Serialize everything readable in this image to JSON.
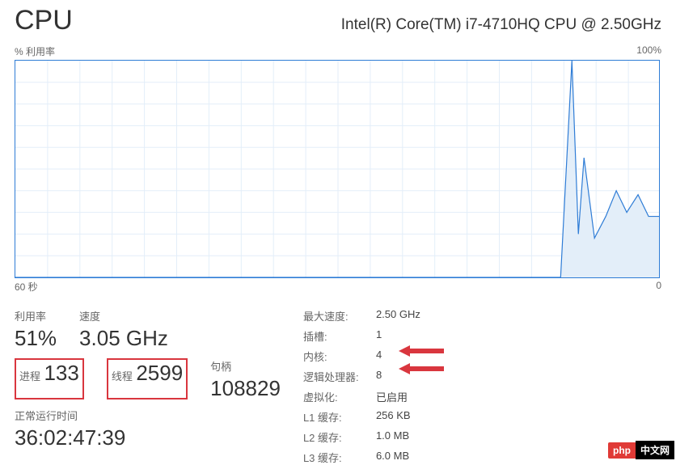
{
  "header": {
    "title": "CPU",
    "cpu_name": "Intel(R) Core(TM) i7-4710HQ CPU @ 2.50GHz"
  },
  "chart": {
    "top_left": "% 利用率",
    "top_right": "100%",
    "bottom_left": "60 秒",
    "bottom_right": "0"
  },
  "chart_data": {
    "type": "line",
    "title": "% 利用率",
    "xlabel": "秒",
    "ylabel": "% 利用率",
    "xlim": [
      60,
      0
    ],
    "ylim": [
      0,
      100
    ],
    "x": [
      60,
      57,
      54,
      51,
      48,
      45,
      42,
      39,
      36,
      33,
      30,
      27,
      24,
      21,
      18,
      15,
      12,
      9,
      8,
      7.5,
      7,
      6,
      5,
      4,
      3,
      2,
      1,
      0
    ],
    "values": [
      0,
      0,
      0,
      0,
      0,
      0,
      0,
      0,
      0,
      0,
      0,
      0,
      0,
      0,
      0,
      0,
      0,
      0,
      100,
      20,
      55,
      18,
      28,
      40,
      30,
      38,
      28,
      28
    ]
  },
  "stats": {
    "utilization": {
      "label": "利用率",
      "value": "51%"
    },
    "speed": {
      "label": "速度",
      "value": "3.05 GHz"
    },
    "processes": {
      "label": "进程",
      "value": "133"
    },
    "threads": {
      "label": "线程",
      "value": "2599"
    },
    "handles": {
      "label": "句柄",
      "value": "108829"
    },
    "uptime": {
      "label": "正常运行时间",
      "value": "36:02:47:39"
    }
  },
  "details": {
    "max_speed": {
      "label": "最大速度:",
      "value": "2.50 GHz"
    },
    "sockets": {
      "label": "插槽:",
      "value": "1"
    },
    "cores": {
      "label": "内核:",
      "value": "4"
    },
    "logical": {
      "label": "逻辑处理器:",
      "value": "8"
    },
    "virtualization": {
      "label": "虚拟化:",
      "value": "已启用"
    },
    "l1": {
      "label": "L1 缓存:",
      "value": "256 KB"
    },
    "l2": {
      "label": "L2 缓存:",
      "value": "1.0 MB"
    },
    "l3": {
      "label": "L3 缓存:",
      "value": "6.0 MB"
    }
  },
  "watermark": {
    "php": "php",
    "cn": "中文网"
  }
}
